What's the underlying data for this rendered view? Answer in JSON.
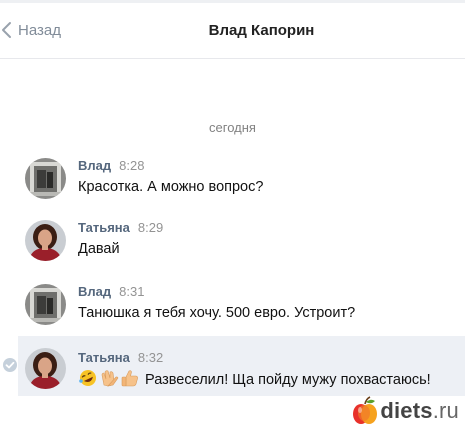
{
  "header": {
    "back_label": "Назад",
    "title": "Влад Капорин"
  },
  "date_separator": "сегодня",
  "messages": [
    {
      "author": "Влад",
      "time": "8:28",
      "text": "Красотка. А можно вопрос?"
    },
    {
      "author": "Татьяна",
      "time": "8:29",
      "text": "Давай"
    },
    {
      "author": "Влад",
      "time": "8:31",
      "text": "Танюшка я тебя хочу. 500 евро. Устроит?"
    },
    {
      "author": "Татьяна",
      "time": "8:32",
      "text": "Развеселил! Ща пойду мужу похвастаюсь!",
      "emojis": [
        "rolling-laughing-emoji",
        "clapping-hands-emoji",
        "thumbs-up-emoji"
      ]
    }
  ],
  "watermark": {
    "brand": "diets",
    "tld": ".ru"
  },
  "colors": {
    "author": "#55677d",
    "time": "#939393",
    "back": "#818c99",
    "highlight": "#edf0f5"
  },
  "icons": {
    "back": "chevron-left-icon",
    "selected": "check-circle-icon",
    "logo": "apple-logo-icon"
  }
}
